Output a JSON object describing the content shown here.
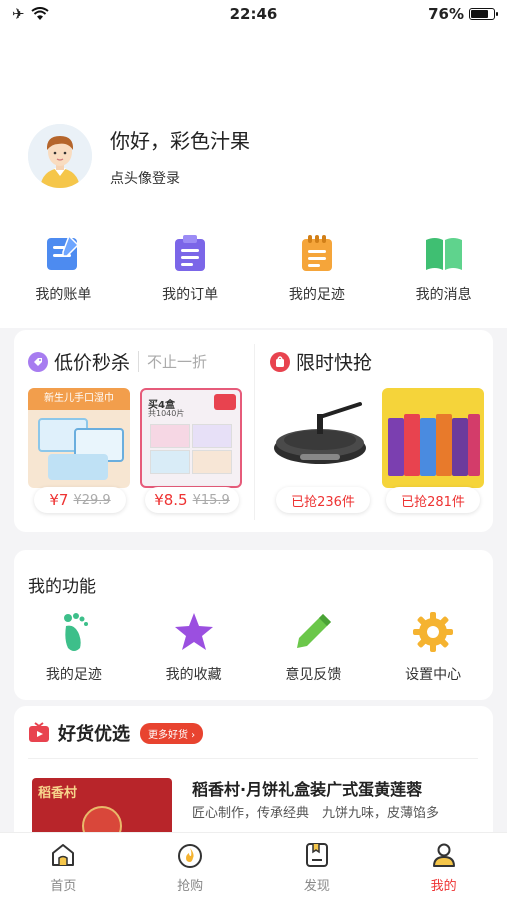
{
  "status_bar": {
    "time": "22:46",
    "battery": "76%",
    "battery_level": 0.76
  },
  "profile": {
    "greeting": "你好，彩色汁果",
    "login_hint": "点头像登录"
  },
  "quick_actions": [
    {
      "label": "我的账单",
      "icon": "bill-icon"
    },
    {
      "label": "我的订单",
      "icon": "order-icon"
    },
    {
      "label": "我的足迹",
      "icon": "footprint-notebook-icon"
    },
    {
      "label": "我的消息",
      "icon": "message-book-icon"
    }
  ],
  "flash_sale": {
    "title": "低价秒杀",
    "subtitle": "不止一折",
    "products": [
      {
        "price": "¥7",
        "old_price": "¥29.9",
        "image_text": "新生儿手口湿巾"
      },
      {
        "price": "¥8.5",
        "old_price": "¥15.9",
        "image_text": "买4盒",
        "image_sub": "共1040片"
      }
    ]
  },
  "limited_grab": {
    "title": "限时快抢",
    "products": [
      {
        "count": "已抢236件"
      },
      {
        "count": "已抢281件"
      }
    ]
  },
  "functions": {
    "title": "我的功能",
    "items": [
      {
        "label": "我的足迹",
        "icon": "foot-icon"
      },
      {
        "label": "我的收藏",
        "icon": "star-icon"
      },
      {
        "label": "意见反馈",
        "icon": "pencil-icon"
      },
      {
        "label": "设置中心",
        "icon": "gear-icon"
      }
    ]
  },
  "goods": {
    "title": "好货优选",
    "more_label": "更多好货 ›",
    "item": {
      "name": "稻香村·月饼礼盒装广式蛋黄莲蓉",
      "desc": "匠心制作，传承经典　九饼九味，皮薄馅多",
      "brand": "稻香村"
    }
  },
  "tabbar": [
    {
      "label": "首页",
      "icon": "home-icon",
      "active": false
    },
    {
      "label": "抢购",
      "icon": "flame-icon",
      "active": false
    },
    {
      "label": "发现",
      "icon": "discover-icon",
      "active": false
    },
    {
      "label": "我的",
      "icon": "user-icon",
      "active": true
    }
  ],
  "colors": {
    "accent": "#e33333",
    "blue": "#3b7be8",
    "purple": "#7b5be8",
    "orange": "#f0a030",
    "green": "#35b86a"
  }
}
